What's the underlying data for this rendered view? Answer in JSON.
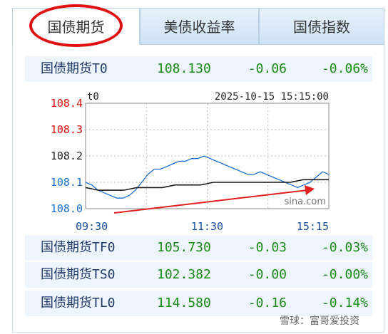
{
  "tabs": [
    {
      "label": "国债期货"
    },
    {
      "label": "美债收益率"
    },
    {
      "label": "国债指数"
    }
  ],
  "rows": [
    {
      "name": "国债期货T0",
      "price": "108.130",
      "change": "-0.06",
      "pct": "-0.06%"
    },
    {
      "name": "国债期货TF0",
      "price": "105.730",
      "change": "-0.03",
      "pct": "-0.03%"
    },
    {
      "name": "国债期货TS0",
      "price": "102.382",
      "change": "-0.00",
      "pct": "-0.00%"
    },
    {
      "name": "国债期货TL0",
      "price": "114.580",
      "change": "-0.16",
      "pct": "-0.14%"
    }
  ],
  "chart_data": {
    "type": "line",
    "title": "t0",
    "timestamp": "2025-10-15 15:15:00",
    "y_tick_labels": [
      "108.4",
      "108.3",
      "108.2",
      "108.1",
      "108.0"
    ],
    "x_tick_labels": [
      "09:30",
      "11:30",
      "15:15"
    ],
    "ylim": [
      108.0,
      108.4
    ],
    "grid": true,
    "series": [
      {
        "values": [
          108.1,
          108.09,
          108.07,
          108.06,
          108.05,
          108.04,
          108.04,
          108.05,
          108.07,
          108.1,
          108.13,
          108.15,
          108.15,
          108.16,
          108.17,
          108.18,
          108.18,
          108.19,
          108.19,
          108.2,
          108.19,
          108.18,
          108.17,
          108.16,
          108.15,
          108.14,
          108.13,
          108.13,
          108.14,
          108.13,
          108.12,
          108.11,
          108.1,
          108.09,
          108.08,
          108.09,
          108.1,
          108.12,
          108.14,
          108.13
        ]
      },
      {
        "values": [
          108.08,
          108.07,
          108.07,
          108.07,
          108.08,
          108.08,
          108.08,
          108.09,
          108.09,
          108.09,
          108.1,
          108.1,
          108.1,
          108.1,
          108.1,
          108.1,
          108.1,
          108.11,
          108.11,
          108.11
        ]
      }
    ],
    "watermark": "sina.com"
  },
  "watermark": "雪球：富哥爱投资",
  "colors": {
    "price_line": "#1a6fd0",
    "avg_line": "#1a1a1a",
    "arrow": "#e02020",
    "circle": "#e01010",
    "up_tick": "#e01010"
  }
}
